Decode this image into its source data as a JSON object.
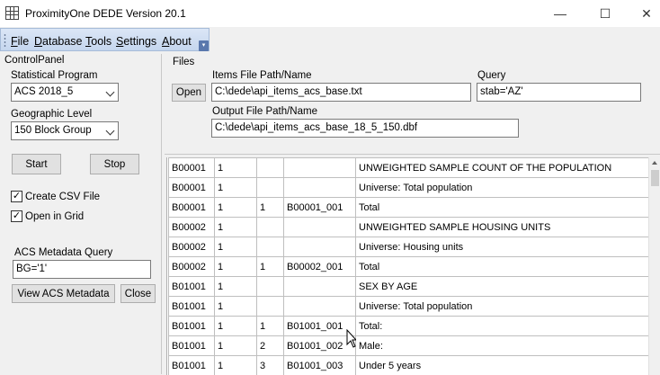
{
  "window": {
    "title": "ProximityOne DEDE Version 20.1",
    "minimize": "—",
    "maximize": "☐",
    "close": "✕"
  },
  "menu": {
    "items": [
      {
        "label": "File",
        "accel": "F",
        "rest": "ile"
      },
      {
        "label": "Database",
        "accel": "D",
        "rest": "atabase"
      },
      {
        "label": "Tools",
        "accel": "T",
        "rest": "ools"
      },
      {
        "label": "Settings",
        "accel": "S",
        "rest": "ettings"
      },
      {
        "label": "About",
        "accel": "A",
        "rest": "bout"
      }
    ]
  },
  "control_panel": {
    "title": "ControlPanel",
    "statistical_program_label": "Statistical Program",
    "statistical_program_value": "ACS 2018_5",
    "geographic_level_label": "Geographic Level",
    "geographic_level_value": "150 Block Group",
    "start_label": "Start",
    "stop_label": "Stop",
    "create_csv_label": "Create CSV File",
    "create_csv_checked": true,
    "open_grid_label": "Open in Grid",
    "open_grid_checked": true,
    "metadata_query_label": "ACS Metadata Query",
    "metadata_query_value": "BG='1'",
    "view_metadata_label": "View ACS Metadata",
    "close_label": "Close"
  },
  "files": {
    "title": "Files",
    "open_label": "Open",
    "items_path_label": "Items File Path/Name",
    "items_path_value": "C:\\dede\\api_items_acs_base.txt",
    "query_label": "Query",
    "query_value": "stab='AZ'",
    "output_path_label": "Output File Path/Name",
    "output_path_value": "C:\\dede\\api_items_acs_base_18_5_150.dbf"
  },
  "grid": {
    "rows": [
      [
        "B00001",
        "1",
        "",
        "",
        "UNWEIGHTED SAMPLE COUNT OF THE POPULATION"
      ],
      [
        "B00001",
        "1",
        "",
        "",
        "Universe:  Total population"
      ],
      [
        "B00001",
        "1",
        "1",
        "B00001_001",
        "Total"
      ],
      [
        "B00002",
        "1",
        "",
        "",
        "UNWEIGHTED SAMPLE HOUSING UNITS"
      ],
      [
        "B00002",
        "1",
        "",
        "",
        "Universe:  Housing units"
      ],
      [
        "B00002",
        "1",
        "1",
        "B00002_001",
        "Total"
      ],
      [
        "B01001",
        "1",
        "",
        "",
        "SEX BY AGE"
      ],
      [
        "B01001",
        "1",
        "",
        "",
        "Universe:  Total population"
      ],
      [
        "B01001",
        "1",
        "1",
        "B01001_001",
        "Total:"
      ],
      [
        "B01001",
        "1",
        "2",
        "B01001_002",
        "Male:"
      ],
      [
        "B01001",
        "1",
        "3",
        "B01001_003",
        "Under 5 years"
      ]
    ]
  }
}
